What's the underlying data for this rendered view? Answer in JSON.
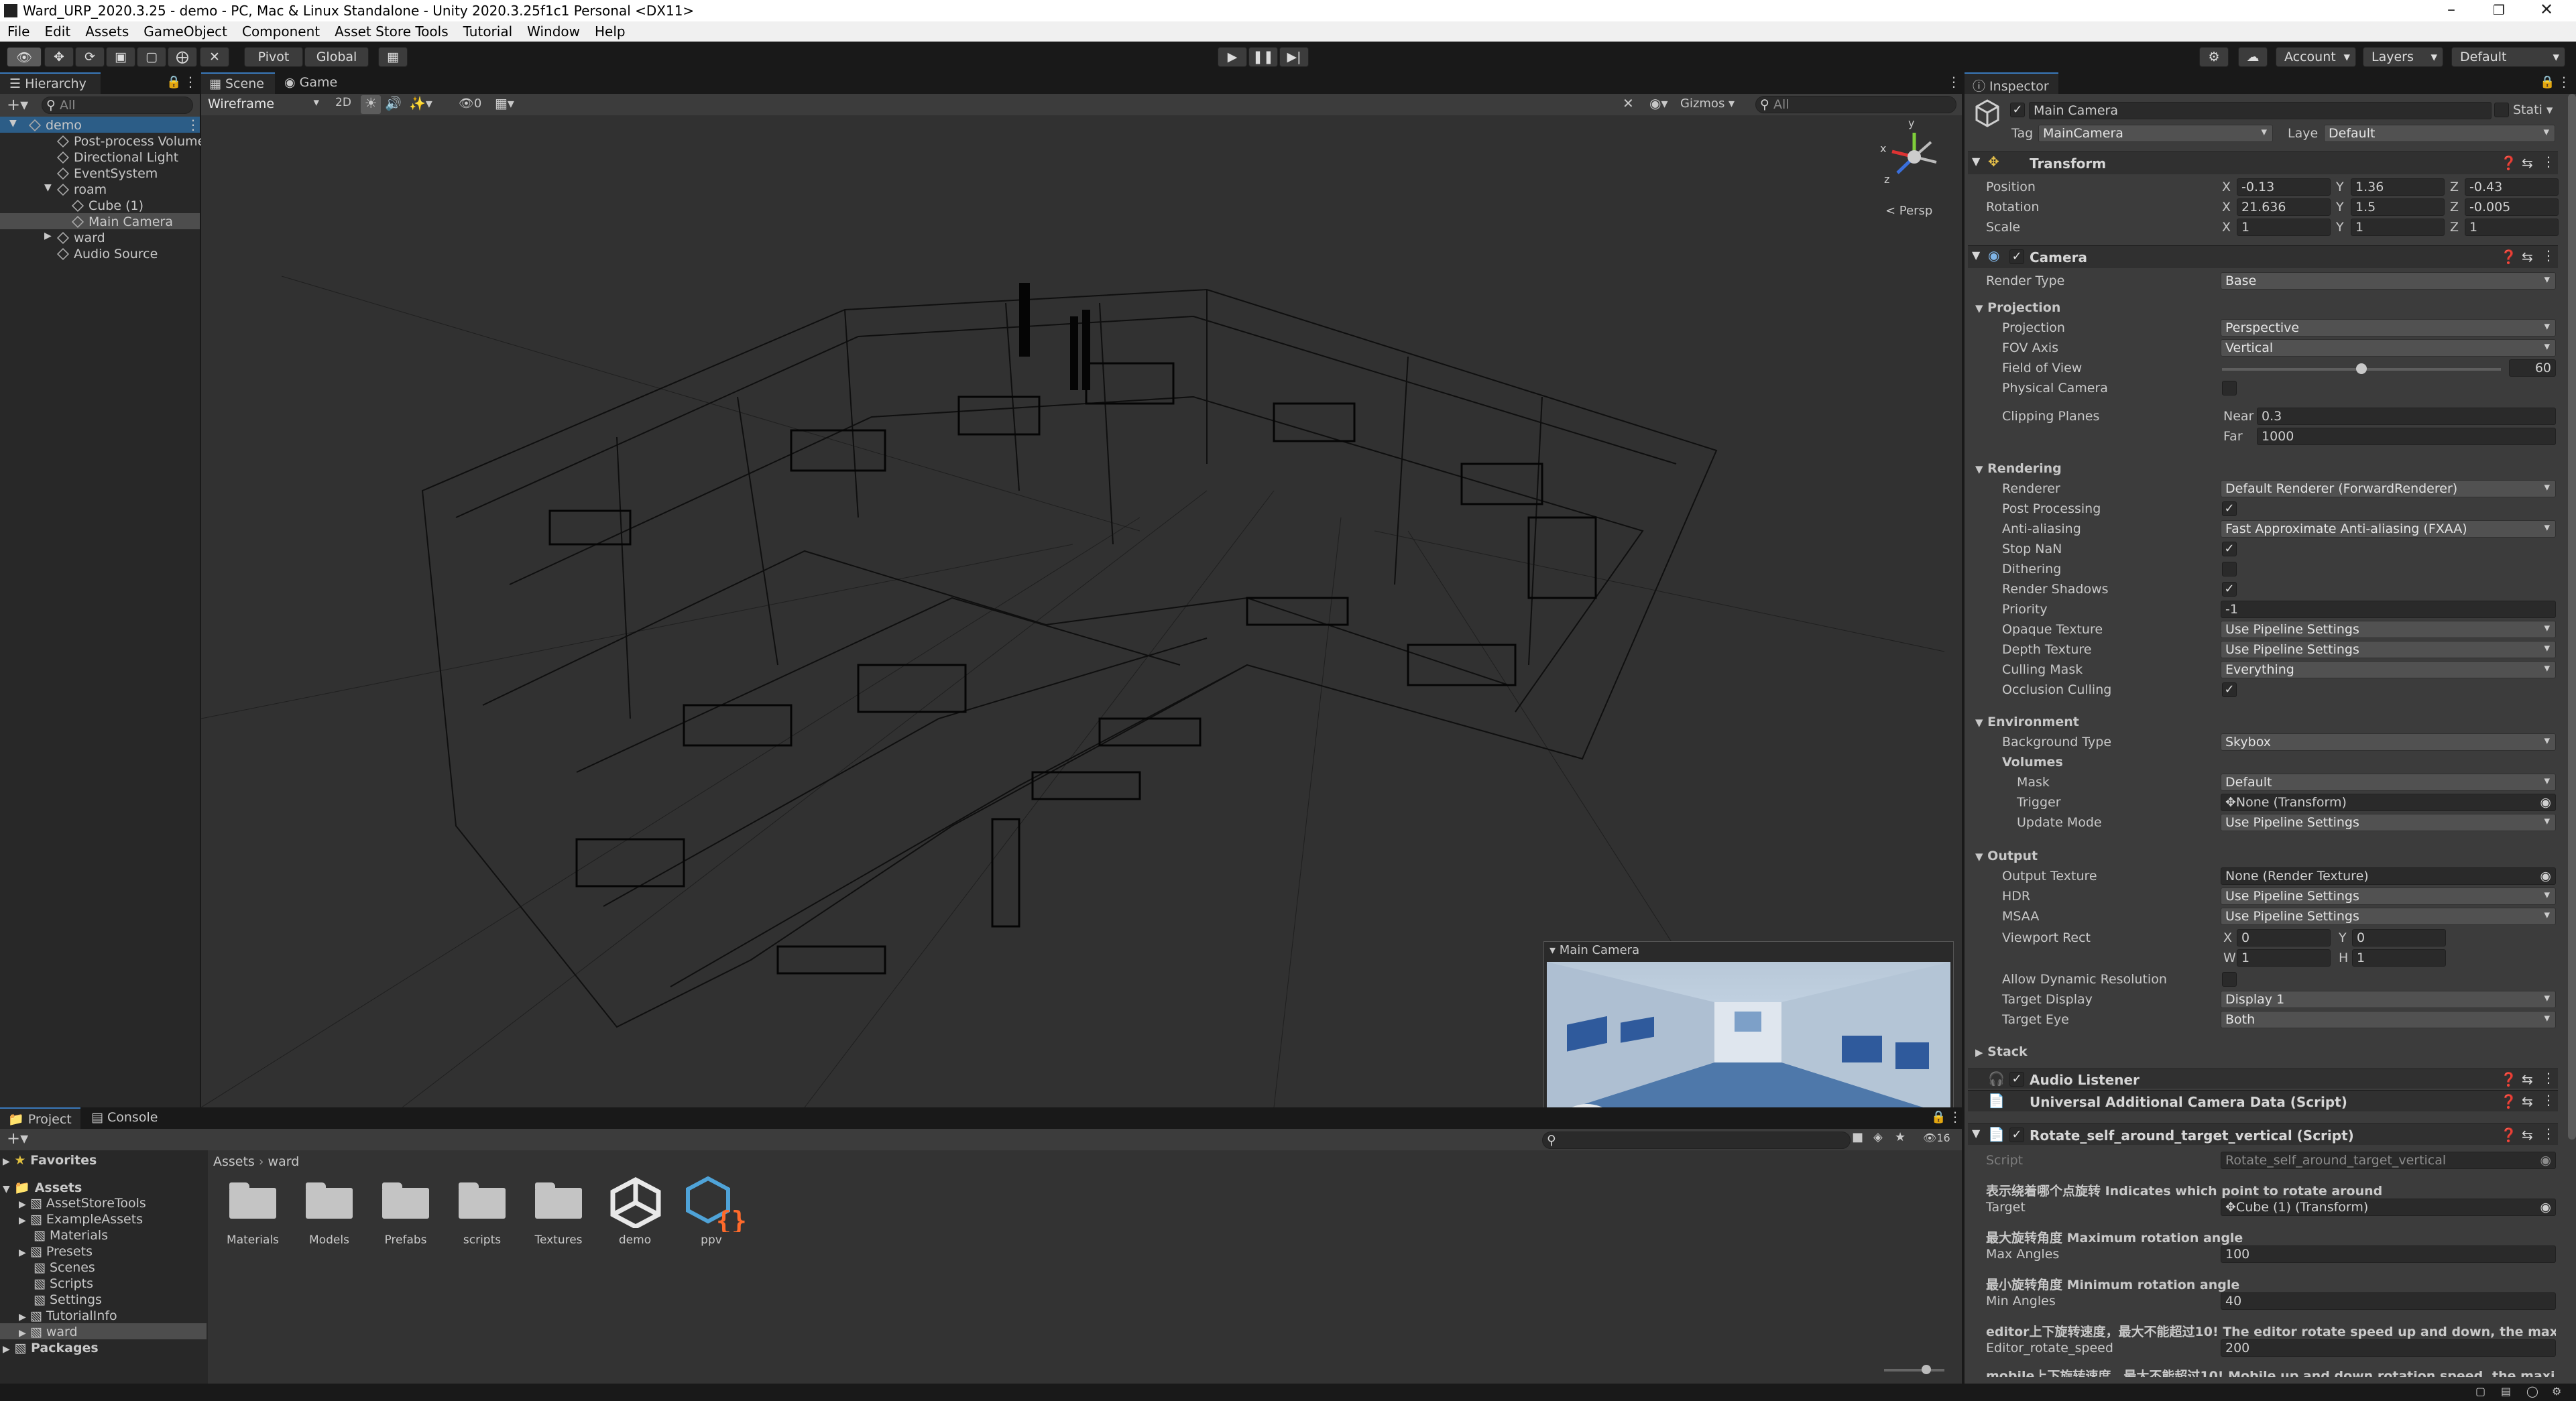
{
  "window": {
    "title": "Ward_URP_2020.3.25 - demo - PC, Mac & Linux Standalone - Unity 2020.3.25f1c1 Personal <DX11>"
  },
  "menu": [
    "File",
    "Edit",
    "Assets",
    "GameObject",
    "Component",
    "Asset Store Tools",
    "Tutorial",
    "Window",
    "Help"
  ],
  "toolbar": {
    "pivot": "Pivot",
    "global": "Global",
    "account": "Account",
    "layers": "Layers",
    "layout": "Default"
  },
  "hierarchy": {
    "tab": "Hierarchy",
    "search_placeholder": "All",
    "items": [
      {
        "label": "demo"
      },
      {
        "label": "Post-process Volume"
      },
      {
        "label": "Directional Light"
      },
      {
        "label": "EventSystem"
      },
      {
        "label": "roam"
      },
      {
        "label": "Cube (1)"
      },
      {
        "label": "Main Camera"
      },
      {
        "label": "ward"
      },
      {
        "label": "Audio Source"
      }
    ]
  },
  "scene": {
    "tabs": [
      "Scene",
      "Game"
    ],
    "draw_mode": "Wireframe",
    "mode_2d": "2D",
    "hidden_count": "0",
    "gizmos": "Gizmos",
    "search_placeholder": "All",
    "persp": "< Persp",
    "gizmo_axes": {
      "x": "x",
      "y": "y",
      "z": "z"
    },
    "preview_title": "Main Camera"
  },
  "project": {
    "tabs": [
      "Project",
      "Console"
    ],
    "badge": "16",
    "breadcrumb": [
      "Assets",
      "ward"
    ],
    "tree": [
      {
        "label": "Favorites"
      },
      {
        "label": "Assets"
      },
      {
        "label": "AssetStoreTools"
      },
      {
        "label": "ExampleAssets"
      },
      {
        "label": "Materials"
      },
      {
        "label": "Presets"
      },
      {
        "label": "Scenes"
      },
      {
        "label": "Scripts"
      },
      {
        "label": "Settings"
      },
      {
        "label": "TutorialInfo"
      },
      {
        "label": "ward"
      },
      {
        "label": "Packages"
      }
    ],
    "assets": [
      {
        "label": "Materials"
      },
      {
        "label": "Models"
      },
      {
        "label": "Prefabs"
      },
      {
        "label": "scripts"
      },
      {
        "label": "Textures"
      },
      {
        "label": "demo"
      },
      {
        "label": "ppv"
      }
    ]
  },
  "inspector": {
    "tab": "Inspector",
    "object_name": "Main Camera",
    "static": "Stati",
    "tag_label": "Tag",
    "tag": "MainCamera",
    "layer_label": "Laye",
    "layer": "Default",
    "transform": {
      "title": "Transform",
      "position": {
        "label": "Position",
        "x": "-0.13",
        "y": "1.36",
        "z": "-0.43"
      },
      "rotation": {
        "label": "Rotation",
        "x": "21.636",
        "y": "1.5",
        "z": "-0.005"
      },
      "scale": {
        "label": "Scale",
        "x": "1",
        "y": "1",
        "z": "1"
      }
    },
    "camera": {
      "title": "Camera",
      "render_type_label": "Render Type",
      "render_type": "Base",
      "projection_section": "Projection",
      "projection_label": "Projection",
      "projection": "Perspective",
      "fov_axis_label": "FOV Axis",
      "fov_axis": "Vertical",
      "fov_label": "Field of View",
      "fov": "60",
      "fov_fraction": 0.5,
      "physical_label": "Physical Camera",
      "clipping_label": "Clipping Planes",
      "near_label": "Near",
      "near": "0.3",
      "far_label": "Far",
      "far": "1000",
      "rendering_section": "Rendering",
      "renderer_label": "Renderer",
      "renderer": "Default Renderer (ForwardRenderer)",
      "post_label": "Post Processing",
      "aa_label": "Anti-aliasing",
      "aa": "Fast Approximate Anti-aliasing (FXAA)",
      "stopnan_label": "Stop NaN",
      "dither_label": "Dithering",
      "shadows_label": "Render Shadows",
      "priority_label": "Priority",
      "priority": "-1",
      "opaque_label": "Opaque Texture",
      "opaque": "Use Pipeline Settings",
      "depth_label": "Depth Texture",
      "depth": "Use Pipeline Settings",
      "culling_label": "Culling Mask",
      "culling": "Everything",
      "occlusion_label": "Occlusion Culling",
      "env_section": "Environment",
      "bg_label": "Background Type",
      "bg": "Skybox",
      "volumes_label": "Volumes",
      "mask_label": "Mask",
      "mask": "Default",
      "trigger_label": "Trigger",
      "trigger": "None (Transform)",
      "update_label": "Update Mode",
      "update": "Use Pipeline Settings",
      "output_section": "Output",
      "out_tex_label": "Output Texture",
      "out_tex": "None (Render Texture)",
      "hdr_label": "HDR",
      "hdr": "Use Pipeline Settings",
      "msaa_label": "MSAA",
      "msaa": "Use Pipeline Settings",
      "viewport_label": "Viewport Rect",
      "vx": "0",
      "vy": "0",
      "vw": "1",
      "vh": "1",
      "dyn_res_label": "Allow Dynamic Resolution",
      "display_label": "Target Display",
      "display": "Display 1",
      "eye_label": "Target Eye",
      "eye": "Both",
      "stack_section": "Stack"
    },
    "audio_listener": "Audio Listener",
    "urp_data": "Universal Additional Camera Data (Script)",
    "rotate_script": {
      "title": "Rotate_self_around_target_vertical (Script)",
      "script_label": "Script",
      "script": "Rotate_self_around_target_vertical",
      "target_header": "表示绕着哪个点旋转 Indicates which point to rotate around",
      "target_label": "Target",
      "target": "Cube (1) (Transform)",
      "max_header": "最大旋转角度 Maximum rotation angle",
      "max_label": "Max Angles",
      "max": "100",
      "min_header": "最小旋转角度 Minimum rotation angle",
      "min_label": "Min Angles",
      "min": "40",
      "editor_header": "editor上下旋转速度，最大不能超过10!  The editor rotate speed up and down, the maximum canr",
      "editor_label": "Editor_rotate_speed",
      "editor": "200",
      "mobile_header": "mobile上下旋转速度，最大不能超过10!  Mobile up and down rotation speed, the maximum can r"
    }
  }
}
